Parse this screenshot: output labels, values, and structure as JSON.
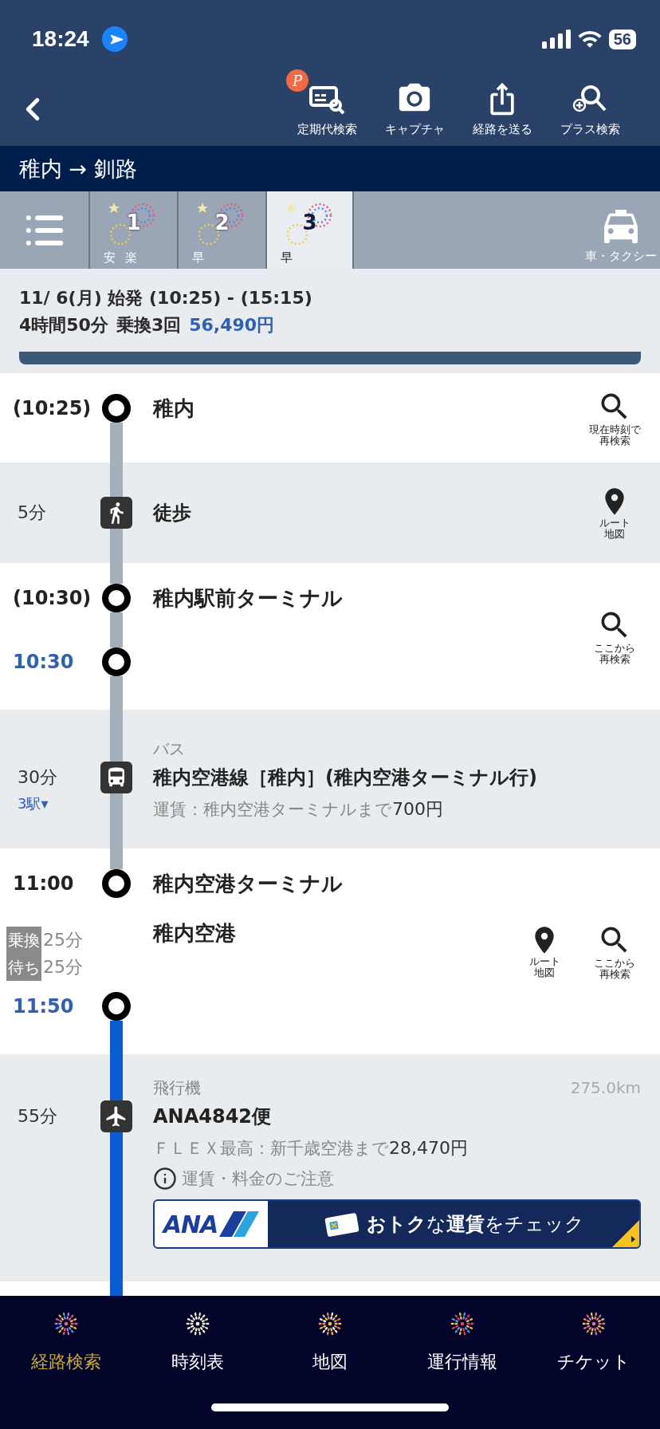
{
  "status_bar": {
    "time": "18:24",
    "battery": "56"
  },
  "toolbar": {
    "items": [
      {
        "kind": "pass-search",
        "label": "定期代検索",
        "badge": "P"
      },
      {
        "kind": "camera",
        "label": "キャプチャ"
      },
      {
        "kind": "share",
        "label": "経路を送る"
      },
      {
        "kind": "plus-search",
        "label": "プラス検索"
      }
    ]
  },
  "route_title": "稚内 → 釧路",
  "result_tabs": {
    "tabs": [
      {
        "number": "1",
        "tags": [
          "安",
          "楽"
        ],
        "selected": false
      },
      {
        "number": "2",
        "tags": [
          "早"
        ],
        "selected": false
      },
      {
        "number": "3",
        "tags": [
          "早"
        ],
        "selected": true
      }
    ],
    "taxi_label": "車・タクシー"
  },
  "summary": {
    "date_line": "11/ 6(月) 始発 (10:25) - (15:15)",
    "duration": "4時間50分",
    "transfers": "乗換3回",
    "fare": "56,490円"
  },
  "timeline": [
    {
      "kind": "station",
      "stops": [
        {
          "kind": "stop",
          "time": "(10:25)",
          "highlighted": false,
          "name": "稚内"
        }
      ],
      "actions": [
        {
          "kind": "search",
          "label_lines": [
            "現在時刻で",
            "再検索"
          ]
        }
      ]
    },
    {
      "kind": "walk",
      "duration": "5分",
      "name": "徒歩",
      "actions": [
        {
          "kind": "map",
          "label_lines": [
            "ルート",
            "地図"
          ]
        }
      ]
    },
    {
      "kind": "station",
      "inner_line": true,
      "stops": [
        {
          "kind": "stop",
          "time": "(10:30)",
          "highlighted": false,
          "name": "稚内駅前ターミナル"
        },
        {
          "kind": "stop",
          "time": "10:30",
          "highlighted": true
        }
      ],
      "actions": [
        {
          "kind": "search",
          "label_lines": [
            "ここから",
            "再検索"
          ]
        }
      ]
    },
    {
      "kind": "bus",
      "duration": "30分",
      "stops_link": "3駅▾",
      "type_label": "バス",
      "name": "稚内空港線［稚内］(稚内空港ターミナル行)",
      "fare": "運賃：稚内空港ターミナルまで",
      "fare_amount": "700円"
    },
    {
      "kind": "station",
      "inner_line": false,
      "stops": [
        {
          "kind": "stop",
          "time": "11:00",
          "highlighted": false,
          "name": "稚内空港ターミナル"
        },
        {
          "kind": "transfer",
          "waits": [
            {
              "label": "乗換",
              "value": "25分"
            },
            {
              "label": "待ち",
              "value": "25分"
            }
          ],
          "name": "稚内空港"
        },
        {
          "kind": "stop",
          "time": "11:50",
          "highlighted": true
        }
      ],
      "actions": [
        {
          "kind": "map",
          "label_lines": [
            "ルート",
            "地図"
          ]
        },
        {
          "kind": "search",
          "label_lines": [
            "ここから",
            "再検索"
          ]
        }
      ]
    },
    {
      "kind": "plane",
      "duration": "55分",
      "type_label": "飛行機",
      "distance": "275.0km",
      "name": "ANA4842便",
      "fare": "ＦＬＥＸ最高：新千歳空港まで",
      "fare_amount": "28,470円",
      "notice": "運賃・料金のご注意",
      "banner": {
        "logo": "ANA",
        "text": "**おトク**な**運賃**をチェック"
      }
    }
  ],
  "bottom_nav": [
    {
      "label": "経路検索",
      "selected": true
    },
    {
      "label": "時刻表",
      "selected": false
    },
    {
      "label": "地図",
      "selected": false
    },
    {
      "label": "運行情報",
      "selected": false
    },
    {
      "label": "チケット",
      "selected": false
    }
  ]
}
